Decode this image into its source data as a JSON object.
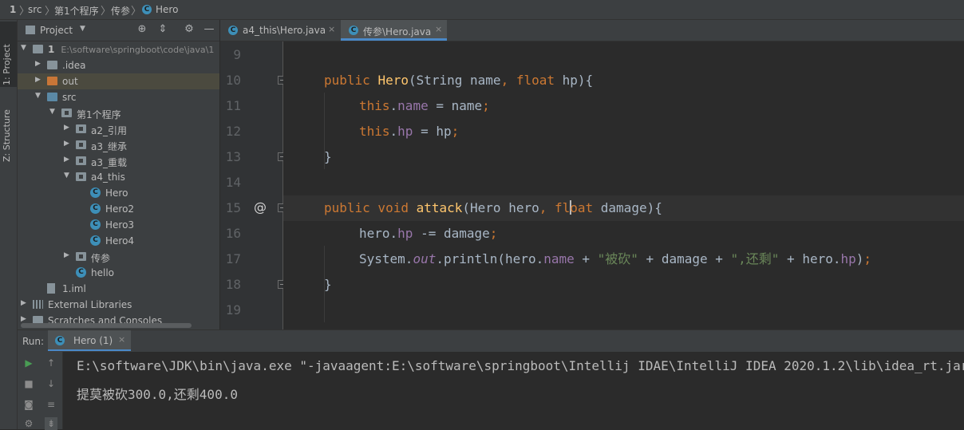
{
  "breadcrumb": [
    "1",
    "src",
    "第1个程序",
    "传参",
    "Hero"
  ],
  "left_strip": [
    "1: Project",
    "Z: Structure"
  ],
  "project_panel": {
    "title": "Project",
    "tree": [
      {
        "label": "1",
        "extra": "E:\\software\\springboot\\code\\java\\1",
        "indent": 0,
        "arrow": "▼",
        "icon": "module"
      },
      {
        "label": ".idea",
        "indent": 1,
        "arrow": "▶",
        "icon": "folder"
      },
      {
        "label": "out",
        "indent": 1,
        "arrow": "▶",
        "icon": "folder-orange",
        "selected": true
      },
      {
        "label": "src",
        "indent": 1,
        "arrow": "▼",
        "icon": "folder-blue"
      },
      {
        "label": "第1个程序",
        "indent": 2,
        "arrow": "▼",
        "icon": "package"
      },
      {
        "label": "a2_引用",
        "indent": 3,
        "arrow": "▶",
        "icon": "package"
      },
      {
        "label": "a3_继承",
        "indent": 3,
        "arrow": "▶",
        "icon": "package"
      },
      {
        "label": "a3_重载",
        "indent": 3,
        "arrow": "▶",
        "icon": "package"
      },
      {
        "label": "a4_this",
        "indent": 3,
        "arrow": "▼",
        "icon": "package"
      },
      {
        "label": "Hero",
        "indent": 4,
        "arrow": "",
        "icon": "class"
      },
      {
        "label": "Hero2",
        "indent": 4,
        "arrow": "",
        "icon": "class"
      },
      {
        "label": "Hero3",
        "indent": 4,
        "arrow": "",
        "icon": "class"
      },
      {
        "label": "Hero4",
        "indent": 4,
        "arrow": "",
        "icon": "class"
      },
      {
        "label": "传参",
        "indent": 3,
        "arrow": "▶",
        "icon": "package"
      },
      {
        "label": "hello",
        "indent": 3,
        "arrow": "",
        "icon": "class"
      },
      {
        "label": "1.iml",
        "indent": 1,
        "arrow": "",
        "icon": "file"
      },
      {
        "label": "External Libraries",
        "indent": 0,
        "arrow": "▶",
        "icon": "library"
      },
      {
        "label": "Scratches and Consoles",
        "indent": 0,
        "arrow": "▶",
        "icon": "scratch"
      }
    ]
  },
  "editor": {
    "tabs": [
      {
        "label": "a4_this\\Hero.java",
        "close": "×",
        "active": false
      },
      {
        "label": "传参\\Hero.java",
        "close": "×",
        "active": true
      }
    ],
    "lines": [
      {
        "num": "9",
        "tokens": []
      },
      {
        "num": "10",
        "tokens": [
          [
            "k",
            "public "
          ],
          [
            "fn",
            "Hero"
          ],
          [
            "p",
            "(String name"
          ],
          [
            "k",
            ", float "
          ],
          [
            "p",
            "hp){"
          ]
        ]
      },
      {
        "num": "11",
        "tokens": [
          [
            "k",
            "this"
          ],
          [
            "p",
            "."
          ],
          [
            "f",
            "name"
          ],
          [
            "p",
            " = name"
          ],
          [
            "k",
            ";"
          ]
        ]
      },
      {
        "num": "12",
        "tokens": [
          [
            "k",
            "this"
          ],
          [
            "p",
            "."
          ],
          [
            "f",
            "hp"
          ],
          [
            "p",
            " = hp"
          ],
          [
            "k",
            ";"
          ]
        ]
      },
      {
        "num": "13",
        "tokens": [
          [
            "p",
            "}"
          ]
        ]
      },
      {
        "num": "14",
        "tokens": []
      },
      {
        "num": "15",
        "tokens": [
          [
            "k",
            "public void "
          ],
          [
            "fn",
            "attack"
          ],
          [
            "p",
            "(Hero hero"
          ],
          [
            "k",
            ", fl"
          ],
          [
            "caret",
            ""
          ],
          [
            "k",
            "oat "
          ],
          [
            "p",
            "damage){"
          ]
        ]
      },
      {
        "num": "16",
        "tokens": [
          [
            "p",
            "hero."
          ],
          [
            "f",
            "hp "
          ],
          [
            "p",
            "-= damage"
          ],
          [
            "k",
            ";"
          ]
        ]
      },
      {
        "num": "17",
        "tokens": [
          [
            "p",
            "System."
          ],
          [
            "fi",
            "out"
          ],
          [
            "p",
            ".println(hero."
          ],
          [
            "f",
            "name "
          ],
          [
            "p",
            "+ "
          ],
          [
            "s",
            "\"被砍\""
          ],
          [
            "p",
            " + damage + "
          ],
          [
            "s",
            "\",还剩\""
          ],
          [
            "p",
            " + hero."
          ],
          [
            "f",
            "hp"
          ],
          [
            "p",
            ")"
          ],
          [
            "k",
            ";"
          ]
        ]
      },
      {
        "num": "18",
        "tokens": [
          [
            "p",
            "}"
          ]
        ]
      },
      {
        "num": "19",
        "tokens": []
      }
    ],
    "override_marker": "@"
  },
  "run": {
    "label": "Run:",
    "tab": "Hero (1)",
    "tab_close": "×",
    "console": [
      "E:\\software\\JDK\\bin\\java.exe \"-javaagent:E:\\software\\springboot\\Intellij IDAE\\IntelliJ IDEA 2020.1.2\\lib\\idea_rt.jar",
      "提莫被砍300.0,还剩400.0"
    ]
  },
  "colors": {
    "keyword": "#cc7832",
    "method": "#ffc66d",
    "field": "#9876aa",
    "string": "#6a8759",
    "text": "#a9b7c6",
    "accent": "#4a88c7"
  }
}
